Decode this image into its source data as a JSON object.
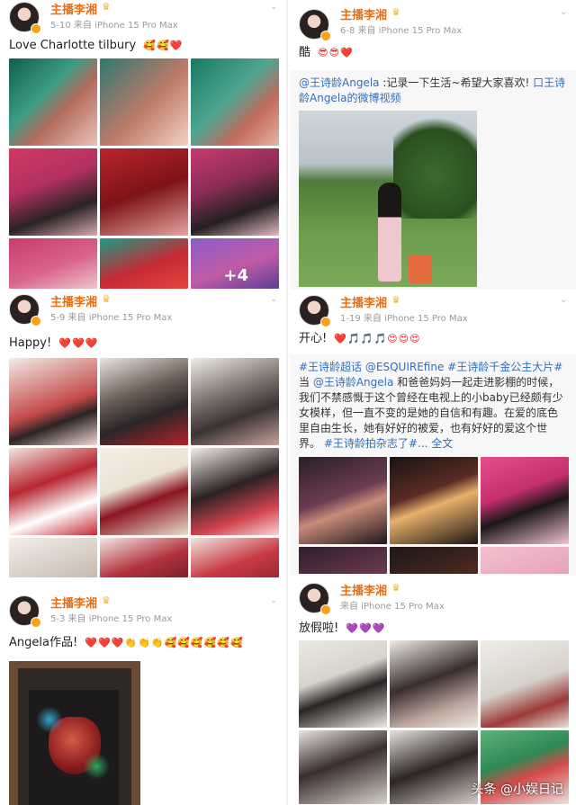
{
  "colors": {
    "name_orange": "#e86e12",
    "meta_gray": "#9a9a9a",
    "link_blue": "#2f6ebd",
    "heart_red": "#e3342f"
  },
  "left": {
    "posts": [
      {
        "author": "主播李湘",
        "date": "5-10",
        "source": "来自 iPhone 15 Pro Max",
        "text": "Love Charlotte tilbury",
        "emoji": "🥰🥰❤️",
        "more_label": "+4"
      },
      {
        "author": "主播李湘",
        "date": "5-9",
        "source": "来自 iPhone 15 Pro Max",
        "text": "Happy!",
        "emoji": "❤️❤️❤️"
      },
      {
        "author": "主播李湘",
        "date": "5-3",
        "source": "来自 iPhone 15 Pro Max",
        "text": "Angela作品!",
        "emoji": "❤️❤️❤️👏👏👏🥰🥰🥰🥰🥰🥰"
      }
    ]
  },
  "right": {
    "posts": [
      {
        "author": "主播李湘",
        "date": "6-8",
        "source": "来自 iPhone 15 Pro Max",
        "text": "酷",
        "emoji": "😎😎❤️",
        "repost_handle": "@王诗龄Angela",
        "repost_text": ":记录一下生活~希望大家喜欢!",
        "repost_video_link": "口王诗龄Angela的微博视频"
      },
      {
        "author": "主播李湘",
        "date": "1-19",
        "source": "来自 iPhone 15 Pro Max",
        "text": "开心!",
        "emoji": "❤️🎵🎵🎵😍😍😍",
        "repost_topic": "#王诗龄超话",
        "repost_mention": "@ESQUIREfine",
        "repost_tag": "#王诗龄千金公主大片#",
        "repost_body_1": "当",
        "repost_mention2": "@王诗龄Angela",
        "repost_body_2": "和爸爸妈妈一起走进影棚的时候，我们不禁感慨于这个曾经在电视上的小baby已经颇有少女模样，但一直不变的是她的自信和有趣。在爱的底色里自由生长，她有好好的被爱，也有好好的爱这个世界。",
        "repost_tag2": "#王诗龄拍杂志了#...",
        "repost_full": "全文"
      },
      {
        "author": "主播李湘",
        "source": "来自 iPhone 15 Pro Max",
        "text": "放假啦!",
        "emoji": "💜💜💜"
      }
    ]
  },
  "watermark": "头条 @小娱日记"
}
